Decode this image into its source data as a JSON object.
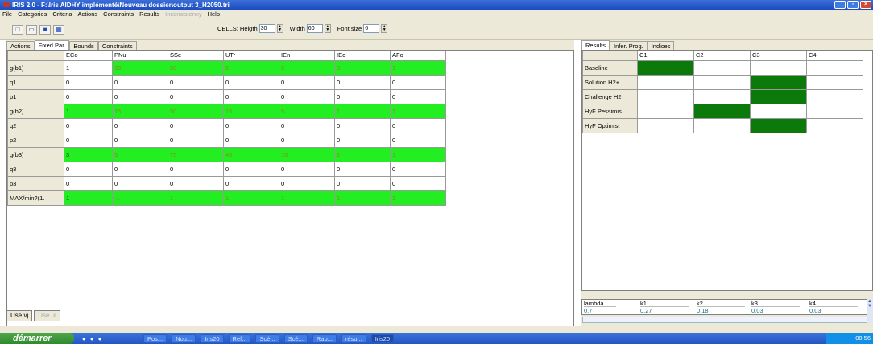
{
  "window": {
    "title": "IRIS 2.0  -  F:\\Iris AIDHY implémenté\\Nouveau dossier\\output 3_H2050.tri",
    "buttons": [
      "_",
      "▫",
      "×"
    ]
  },
  "menu": [
    "File",
    "Categories",
    "Criteria",
    "Actions",
    "Constraints",
    "Results"
  ],
  "menu_disabled": "Inconsistency",
  "menu_help": "Help",
  "toolbar": {
    "cells_label": "CELLS: Heigth",
    "height": "30",
    "width_label": "Width",
    "width": "60",
    "font_label": "Font size",
    "font": "6"
  },
  "left_tabs": [
    "Actions",
    "Fixed Par.",
    "Bounds",
    "Constraints"
  ],
  "grid": {
    "columns": [
      "ECo",
      "PNu",
      "SSe",
      "UTr",
      "IEn",
      "IEc",
      "AFo"
    ],
    "rows": [
      {
        "label": "g(b1)",
        "values": [
          "1",
          "30",
          "20",
          "5",
          "2",
          "0",
          "1"
        ],
        "green": true,
        "first_white": true
      },
      {
        "label": "q1",
        "values": [
          "0",
          "0",
          "0",
          "0",
          "0",
          "0",
          "0"
        ],
        "green": false
      },
      {
        "label": "p1",
        "values": [
          "0",
          "0",
          "0",
          "0",
          "0",
          "0",
          "0"
        ],
        "green": false
      },
      {
        "label": "g(b2)",
        "values": [
          "1",
          "15",
          "50",
          "15",
          "5",
          "1",
          "1"
        ],
        "green": true
      },
      {
        "label": "q2",
        "values": [
          "0",
          "0",
          "0",
          "0",
          "0",
          "0",
          "0"
        ],
        "green": false
      },
      {
        "label": "p2",
        "values": [
          "0",
          "0",
          "0",
          "0",
          "0",
          "0",
          "0"
        ],
        "green": false
      },
      {
        "label": "g(b3)",
        "values": [
          "3",
          "5",
          "75",
          "40",
          "10",
          "2",
          "1"
        ],
        "green": true
      },
      {
        "label": "q3",
        "values": [
          "0",
          "0",
          "0",
          "0",
          "0",
          "0",
          "0"
        ],
        "green": false
      },
      {
        "label": "p3",
        "values": [
          "0",
          "0",
          "0",
          "0",
          "0",
          "0",
          "0"
        ],
        "green": false
      },
      {
        "label": "MAX/min?(1.",
        "values": [
          "1",
          "-1",
          "1",
          "1",
          "1",
          "1",
          "1"
        ],
        "green": true
      }
    ]
  },
  "buttons": {
    "use_vj": "Use vj",
    "use_ui": "Use ui"
  },
  "right_tabs": [
    "Results",
    "Infer. Prog.",
    "Indices"
  ],
  "results": {
    "columns": [
      "C1",
      "C2",
      "C3",
      "C4"
    ],
    "rows": [
      {
        "label": "Baseline",
        "assigned": 0
      },
      {
        "label": "Solution H2+",
        "assigned": 2
      },
      {
        "label": "Challenge H2",
        "assigned": 2
      },
      {
        "label": "HyF Pessimis",
        "assigned": 1
      },
      {
        "label": "HyF Optimist",
        "assigned": 2
      }
    ],
    "assigned_color": "#0b7a0b"
  },
  "lambda": {
    "label": "lambda",
    "value": "0.7",
    "k": [
      {
        "name": "k1",
        "value": "0.27"
      },
      {
        "name": "k2",
        "value": "0.18"
      },
      {
        "name": "k3",
        "value": "0.03"
      },
      {
        "name": "k4",
        "value": "0.03"
      }
    ]
  },
  "taskbar": {
    "start": "démarrer",
    "items": [
      "Pos...",
      "Nou...",
      "Iris20",
      "Ref...",
      "Scé...",
      "Scé...",
      "Rap...",
      "résu...",
      "Iris20"
    ],
    "clock": "08:56"
  }
}
